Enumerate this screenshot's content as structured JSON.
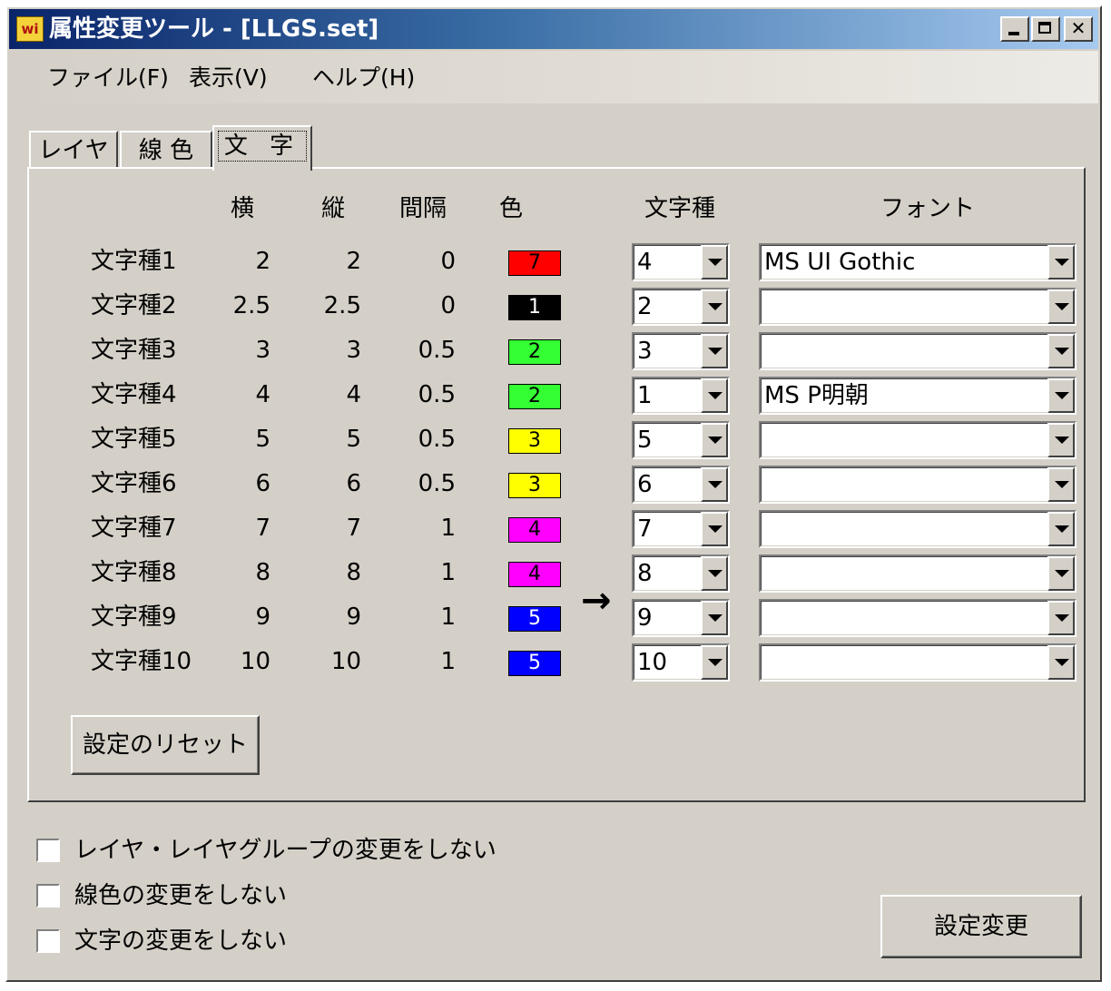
{
  "window": {
    "title": "属性変更ツール - [LLGS.set]",
    "icon": "app-icon",
    "icon_text": "wi"
  },
  "menu": [
    {
      "label": "ファイル(F)"
    },
    {
      "label": "表示(V)"
    },
    {
      "label": "ヘルプ(H)"
    }
  ],
  "tabs": [
    {
      "label": "レイヤ",
      "active": false
    },
    {
      "label": "線 色",
      "active": false
    },
    {
      "label": "文 字",
      "active": true
    }
  ],
  "columns": {
    "width": "横",
    "height": "縦",
    "spacing": "間隔",
    "color": "色",
    "char_type": "文字種",
    "font": "フォント"
  },
  "rows": [
    {
      "label": "文字種1",
      "width": "2",
      "height": "2",
      "spacing": "0",
      "color_num": "7",
      "color": "#ff0000",
      "text_color": "#000000",
      "target": "4",
      "font": "MS UI Gothic"
    },
    {
      "label": "文字種2",
      "width": "2.5",
      "height": "2.5",
      "spacing": "0",
      "color_num": "1",
      "color": "#000000",
      "text_color": "#ffffff",
      "target": "2",
      "font": ""
    },
    {
      "label": "文字種3",
      "width": "3",
      "height": "3",
      "spacing": "0.5",
      "color_num": "2",
      "color": "#33ff33",
      "text_color": "#000000",
      "target": "3",
      "font": ""
    },
    {
      "label": "文字種4",
      "width": "4",
      "height": "4",
      "spacing": "0.5",
      "color_num": "2",
      "color": "#33ff33",
      "text_color": "#000000",
      "target": "1",
      "font": "MS P明朝"
    },
    {
      "label": "文字種5",
      "width": "5",
      "height": "5",
      "spacing": "0.5",
      "color_num": "3",
      "color": "#ffff00",
      "text_color": "#000000",
      "target": "5",
      "font": ""
    },
    {
      "label": "文字種6",
      "width": "6",
      "height": "6",
      "spacing": "0.5",
      "color_num": "3",
      "color": "#ffff00",
      "text_color": "#000000",
      "target": "6",
      "font": ""
    },
    {
      "label": "文字種7",
      "width": "7",
      "height": "7",
      "spacing": "1",
      "color_num": "4",
      "color": "#ff00ff",
      "text_color": "#000000",
      "target": "7",
      "font": ""
    },
    {
      "label": "文字種8",
      "width": "8",
      "height": "8",
      "spacing": "1",
      "color_num": "4",
      "color": "#ff00ff",
      "text_color": "#000000",
      "target": "8",
      "font": ""
    },
    {
      "label": "文字種9",
      "width": "9",
      "height": "9",
      "spacing": "1",
      "color_num": "5",
      "color": "#0000ff",
      "text_color": "#ffffff",
      "target": "9",
      "font": ""
    },
    {
      "label": "文字種10",
      "width": "10",
      "height": "10",
      "spacing": "1",
      "color_num": "5",
      "color": "#0000ff",
      "text_color": "#ffffff",
      "target": "10",
      "font": ""
    }
  ],
  "arrow": "→",
  "reset_button": "設定のリセット",
  "checkboxes": [
    {
      "label": "レイヤ・レイヤグループの変更をしない",
      "checked": false
    },
    {
      "label": "線色の変更をしない",
      "checked": false
    },
    {
      "label": "文字の変更をしない",
      "checked": false
    }
  ],
  "apply_button": "設定変更"
}
